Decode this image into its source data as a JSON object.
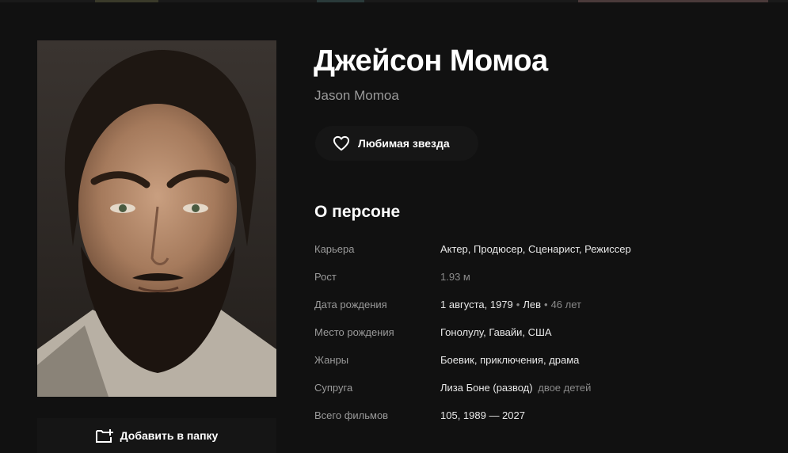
{
  "person": {
    "name": "Джейсон Момоа",
    "original_name": "Jason Momoa"
  },
  "actions": {
    "favorite_label": "Любимая звезда",
    "add_to_folder_label": "Добавить в папку"
  },
  "about": {
    "title": "О персоне",
    "career": {
      "label": "Карьера",
      "value": "Актер, Продюсер, Сценарист, Режиссер"
    },
    "height": {
      "label": "Рост",
      "value": "1.93 м"
    },
    "birth": {
      "label": "Дата рождения",
      "date": "1 августа, 1979",
      "sign": "Лев",
      "age": "46 лет"
    },
    "birthplace": {
      "label": "Место рождения",
      "value": "Гонолулу, Гавайи, США"
    },
    "genres": {
      "label": "Жанры",
      "value": "Боевик, приключения, драма"
    },
    "spouse": {
      "label": "Супруга",
      "value": "Лиза Боне (развод)",
      "note": "двое детей"
    },
    "films": {
      "label": "Всего фильмов",
      "value": "105, 1989 — 2027"
    }
  },
  "icons": {
    "heart": "heart-icon",
    "folder": "folder-add-icon"
  },
  "colors": {
    "background": "#111111",
    "text": "#ffffff",
    "muted": "#9a9a9a"
  }
}
